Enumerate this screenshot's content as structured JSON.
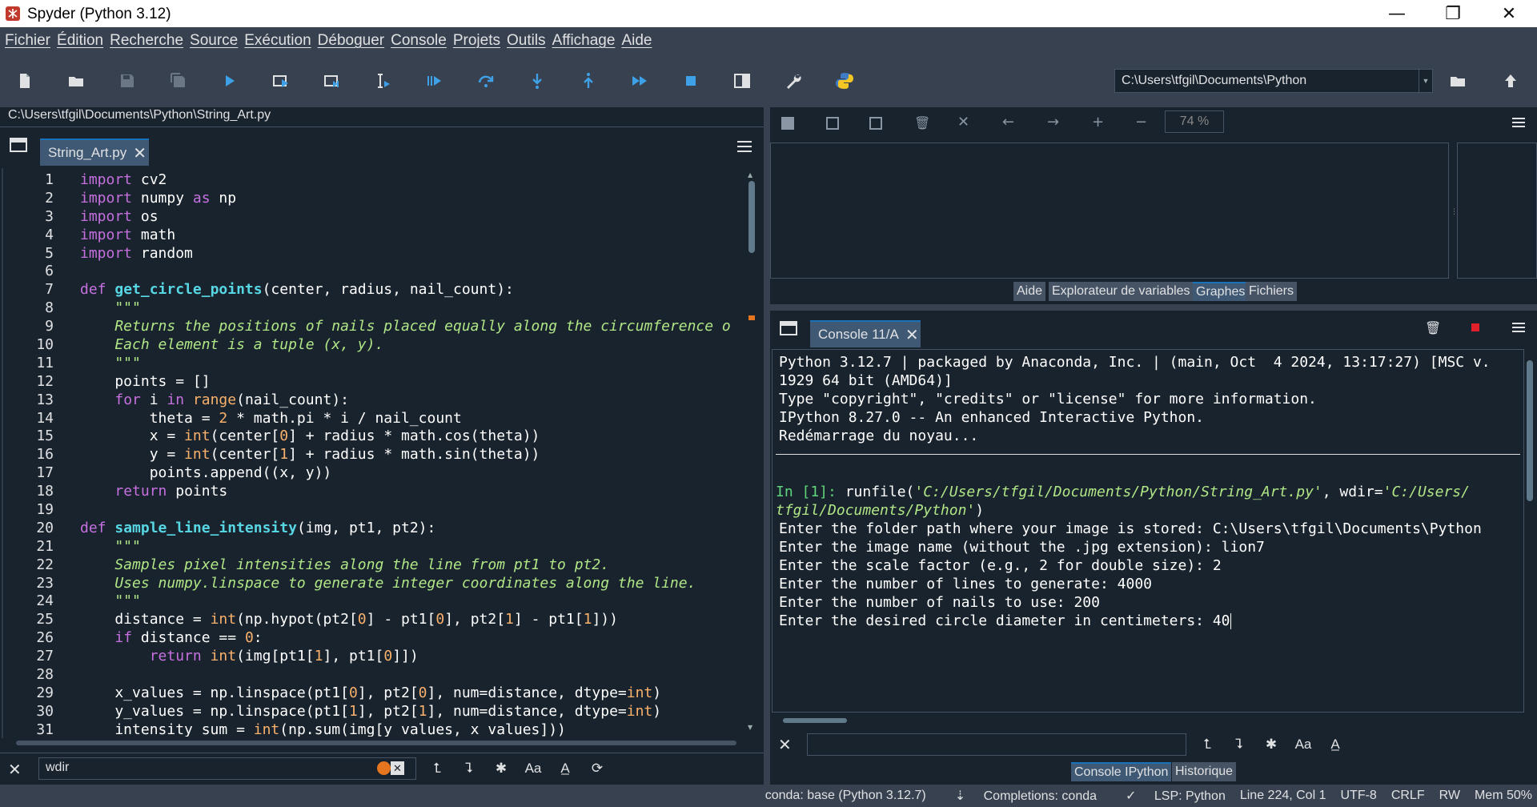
{
  "window": {
    "title": "Spyder (Python 3.12)",
    "minimize_label": "—",
    "restore_label": "❐",
    "close_label": "✕"
  },
  "menu": [
    "Fichier",
    "Édition",
    "Recherche",
    "Source",
    "Exécution",
    "Déboguer",
    "Console",
    "Projets",
    "Outils",
    "Affichage",
    "Aide"
  ],
  "toolbar": {
    "working_dir": "C:\\Users\\tfgil\\Documents\\Python",
    "icons": [
      "new-file-icon",
      "open-file-icon",
      "save-icon",
      "save-all-icon",
      "run-icon",
      "run-cell-icon",
      "run-cell-advance-icon",
      "run-selection-icon",
      "debug-icon",
      "step-over-icon",
      "step-into-icon",
      "step-return-icon",
      "continue-icon",
      "stop-icon",
      "maximize-pane-icon",
      "preferences-icon",
      "python-path-icon"
    ]
  },
  "editor": {
    "file_path": "C:\\Users\\tfgil\\Documents\\Python\\String_Art.py",
    "tab_label": "String_Art.py",
    "tab_close": "✕",
    "line_numbers": [
      "1",
      "2",
      "3",
      "4",
      "5",
      "6",
      "7",
      "8",
      "9",
      "10",
      "11",
      "12",
      "13",
      "14",
      "15",
      "16",
      "17",
      "18",
      "19",
      "20",
      "21",
      "22",
      "23",
      "24",
      "25",
      "26",
      "27",
      "28",
      "29",
      "30",
      "31"
    ],
    "code_lines": [
      "import cv2",
      "import numpy as np",
      "import os",
      "import math",
      "import random",
      "",
      "def get_circle_points(center, radius, nail_count):",
      "    \"\"\"",
      "    Returns the positions of nails placed equally along the circumference o",
      "    Each element is a tuple (x, y).",
      "    \"\"\"",
      "    points = []",
      "    for i in range(nail_count):",
      "        theta = 2 * math.pi * i / nail_count",
      "        x = int(center[0] + radius * math.cos(theta))",
      "        y = int(center[1] + radius * math.sin(theta))",
      "        points.append((x, y))",
      "    return points",
      "",
      "def sample_line_intensity(img, pt1, pt2):",
      "    \"\"\"",
      "    Samples pixel intensities along the line from pt1 to pt2.",
      "    Uses numpy.linspace to generate integer coordinates along the line.",
      "    \"\"\"",
      "    distance = int(np.hypot(pt2[0] - pt1[0], pt2[1] - pt1[1]))",
      "    if distance == 0:",
      "        return int(img[pt1[1], pt1[0]])",
      "",
      "    x_values = np.linspace(pt1[0], pt2[0], num=distance, dtype=int)",
      "    y_values = np.linspace(pt1[1], pt2[1], num=distance, dtype=int)",
      "    intensity_sum = int(np.sum(img[y_values, x_values]))"
    ],
    "find_value": "wdir"
  },
  "plots": {
    "zoom": "74 %",
    "tabs": [
      "Aide",
      "Explorateur de variables",
      "Graphes",
      "Fichiers"
    ],
    "active_tab": "Graphes"
  },
  "console": {
    "tab_label": "Console 11/A",
    "tab_close": "✕",
    "lines": [
      "Python 3.12.7 | packaged by Anaconda, Inc. | (main, Oct  4 2024, 13:17:27) [MSC v.",
      "1929 64 bit (AMD64)]",
      "Type \"copyright\", \"credits\" or \"license\" for more information.",
      "",
      "IPython 8.27.0 -- An enhanced Interactive Python.",
      "",
      "Redémarrage du noyau..."
    ],
    "prompt": "In [1]:",
    "run_cmd_pre": " runfile(",
    "run_cmd_str1": "'C:/Users/tfgil/Documents/Python/String_Art.py'",
    "run_cmd_mid": ", wdir=",
    "run_cmd_str2a": "'C:/Users/",
    "run_cmd_str2b": "tfgil/Documents/Python'",
    "run_cmd_end": ")",
    "output": [
      "Enter the folder path where your image is stored: C:\\Users\\tfgil\\Documents\\Python",
      "Enter the image name (without the .jpg extension): lion7",
      "Enter the scale factor (e.g., 2 for double size): 2",
      "Enter the number of lines to generate: 4000",
      "Enter the number of nails to use: 200",
      "Enter the desired circle diameter in centimeters: 40"
    ],
    "bottom_tabs": [
      "Console IPython",
      "Historique"
    ],
    "active_bottom_tab": "Console IPython"
  },
  "status": {
    "env": "conda: base (Python 3.12.7)",
    "completions": "Completions: conda",
    "lsp": "LSP: Python",
    "position": "Line 224, Col 1",
    "encoding": "UTF-8",
    "eol": "CRLF",
    "permissions": "RW",
    "memory": "Mem 50%"
  },
  "colors": {
    "background": "#19232d",
    "panel": "#37414f",
    "accent": "#1a72bb",
    "keyword": "#c670e0",
    "function": "#57d6e4",
    "string": "#b0e686",
    "number": "#fab16c"
  }
}
